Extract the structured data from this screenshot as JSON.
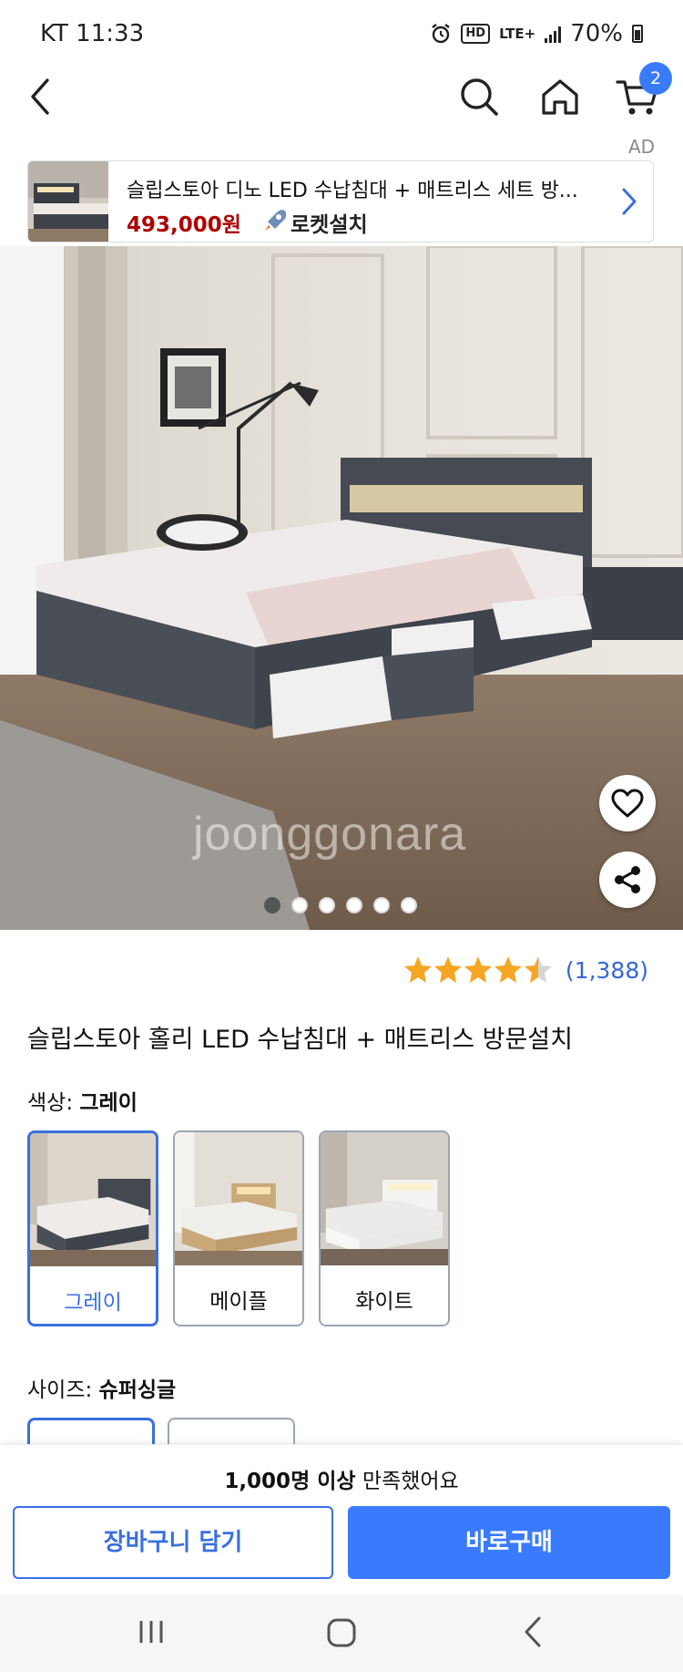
{
  "status_bar": {
    "carrier_time": "KT 11:33",
    "hd_label": "HD",
    "network": "LTE+",
    "battery": "70%"
  },
  "header": {
    "cart_badge": "2",
    "ad_label": "AD"
  },
  "ad_banner": {
    "title": "슬립스토아 디노 LED 수납침대 + 매트리스 세트 방...",
    "price": "493,000원",
    "badge": "로켓설치"
  },
  "hero": {
    "watermark": "joonggonara",
    "image_count": 6,
    "active_index": 0
  },
  "rating": {
    "stars": 4.5,
    "count": "(1,388)"
  },
  "product": {
    "title": "슬립스토아 홀리 LED 수납침대 + 매트리스 방문설치"
  },
  "color_option": {
    "label": "색상:",
    "selected": "그레이",
    "items": [
      {
        "name": "그레이"
      },
      {
        "name": "메이플"
      },
      {
        "name": "화이트"
      }
    ]
  },
  "size_option": {
    "label": "사이즈:",
    "selected": "슈퍼싱글"
  },
  "bottom_bar": {
    "satisfied_bold": "1,000명 이상",
    "satisfied_rest": " 만족했어요",
    "cart_button": "장바구니 담기",
    "buy_button": "바로구매"
  },
  "colors": {
    "accent": "#3a7bfd",
    "price_red": "#ae0000",
    "star": "#f5a623"
  }
}
